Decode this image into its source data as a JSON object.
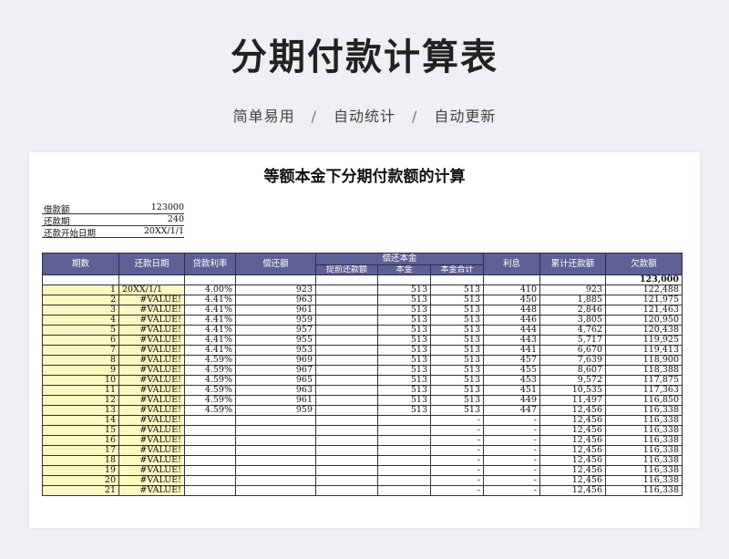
{
  "header": {
    "title": "分期付款计算表",
    "tags": [
      "简单易用",
      "自动统计",
      "自动更新"
    ],
    "separator": "/"
  },
  "sheet": {
    "title": "等额本金下分期付款额的计算",
    "info": [
      {
        "label": "借款额",
        "value": "123000"
      },
      {
        "label": "还款期",
        "value": "240"
      },
      {
        "label": "还款开始日期",
        "value": "20XX/1/1"
      }
    ],
    "columns": {
      "period": "期数",
      "date": "还款日期",
      "rate": "贷款利率",
      "payment": "偿还额",
      "principal_group": "偿还本金",
      "prepay": "提前还款额",
      "principal": "本金",
      "principal_total": "本金合计",
      "interest": "利息",
      "cumulative": "累计还款额",
      "balance": "欠款额"
    },
    "initial_balance": "123,000",
    "rows": [
      {
        "n": "1",
        "date": "20XX/1/1",
        "rate": "4.00%",
        "pay": "923",
        "pre": "",
        "p": "513",
        "pt": "513",
        "i": "410",
        "c": "923",
        "b": "122,488"
      },
      {
        "n": "2",
        "date": "#VALUE!",
        "rate": "4.41%",
        "pay": "963",
        "pre": "",
        "p": "513",
        "pt": "513",
        "i": "450",
        "c": "1,885",
        "b": "121,975"
      },
      {
        "n": "3",
        "date": "#VALUE!",
        "rate": "4.41%",
        "pay": "961",
        "pre": "",
        "p": "513",
        "pt": "513",
        "i": "448",
        "c": "2,846",
        "b": "121,463"
      },
      {
        "n": "4",
        "date": "#VALUE!",
        "rate": "4.41%",
        "pay": "959",
        "pre": "",
        "p": "513",
        "pt": "513",
        "i": "446",
        "c": "3,805",
        "b": "120,950"
      },
      {
        "n": "5",
        "date": "#VALUE!",
        "rate": "4.41%",
        "pay": "957",
        "pre": "",
        "p": "513",
        "pt": "513",
        "i": "444",
        "c": "4,762",
        "b": "120,438"
      },
      {
        "n": "6",
        "date": "#VALUE!",
        "rate": "4.41%",
        "pay": "955",
        "pre": "",
        "p": "513",
        "pt": "513",
        "i": "443",
        "c": "5,717",
        "b": "119,925"
      },
      {
        "n": "7",
        "date": "#VALUE!",
        "rate": "4.41%",
        "pay": "953",
        "pre": "",
        "p": "513",
        "pt": "513",
        "i": "441",
        "c": "6,670",
        "b": "119,413"
      },
      {
        "n": "8",
        "date": "#VALUE!",
        "rate": "4.59%",
        "pay": "969",
        "pre": "",
        "p": "513",
        "pt": "513",
        "i": "457",
        "c": "7,639",
        "b": "118,900"
      },
      {
        "n": "9",
        "date": "#VALUE!",
        "rate": "4.59%",
        "pay": "967",
        "pre": "",
        "p": "513",
        "pt": "513",
        "i": "455",
        "c": "8,607",
        "b": "118,388"
      },
      {
        "n": "10",
        "date": "#VALUE!",
        "rate": "4.59%",
        "pay": "965",
        "pre": "",
        "p": "513",
        "pt": "513",
        "i": "453",
        "c": "9,572",
        "b": "117,875"
      },
      {
        "n": "11",
        "date": "#VALUE!",
        "rate": "4.59%",
        "pay": "963",
        "pre": "",
        "p": "513",
        "pt": "513",
        "i": "451",
        "c": "10,535",
        "b": "117,363"
      },
      {
        "n": "12",
        "date": "#VALUE!",
        "rate": "4.59%",
        "pay": "961",
        "pre": "",
        "p": "513",
        "pt": "513",
        "i": "449",
        "c": "11,497",
        "b": "116,850"
      },
      {
        "n": "13",
        "date": "#VALUE!",
        "rate": "4.59%",
        "pay": "959",
        "pre": "",
        "p": "513",
        "pt": "513",
        "i": "447",
        "c": "12,456",
        "b": "116,338"
      },
      {
        "n": "14",
        "date": "#VALUE!",
        "rate": "",
        "pay": "",
        "pre": "",
        "p": "",
        "pt": "-",
        "i": "-",
        "c": "12,456",
        "b": "116,338"
      },
      {
        "n": "15",
        "date": "#VALUE!",
        "rate": "",
        "pay": "",
        "pre": "",
        "p": "",
        "pt": "-",
        "i": "-",
        "c": "12,456",
        "b": "116,338"
      },
      {
        "n": "16",
        "date": "#VALUE!",
        "rate": "",
        "pay": "",
        "pre": "",
        "p": "",
        "pt": "-",
        "i": "-",
        "c": "12,456",
        "b": "116,338"
      },
      {
        "n": "17",
        "date": "#VALUE!",
        "rate": "",
        "pay": "",
        "pre": "",
        "p": "",
        "pt": "-",
        "i": "-",
        "c": "12,456",
        "b": "116,338"
      },
      {
        "n": "18",
        "date": "#VALUE!",
        "rate": "",
        "pay": "",
        "pre": "",
        "p": "",
        "pt": "-",
        "i": "-",
        "c": "12,456",
        "b": "116,338"
      },
      {
        "n": "19",
        "date": "#VALUE!",
        "rate": "",
        "pay": "",
        "pre": "",
        "p": "",
        "pt": "-",
        "i": "-",
        "c": "12,456",
        "b": "116,338"
      },
      {
        "n": "20",
        "date": "#VALUE!",
        "rate": "",
        "pay": "",
        "pre": "",
        "p": "",
        "pt": "-",
        "i": "-",
        "c": "12,456",
        "b": "116,338"
      },
      {
        "n": "21",
        "date": "#VALUE!",
        "rate": "",
        "pay": "",
        "pre": "",
        "p": "",
        "pt": "-",
        "i": "-",
        "c": "12,456",
        "b": "116,338"
      }
    ]
  }
}
